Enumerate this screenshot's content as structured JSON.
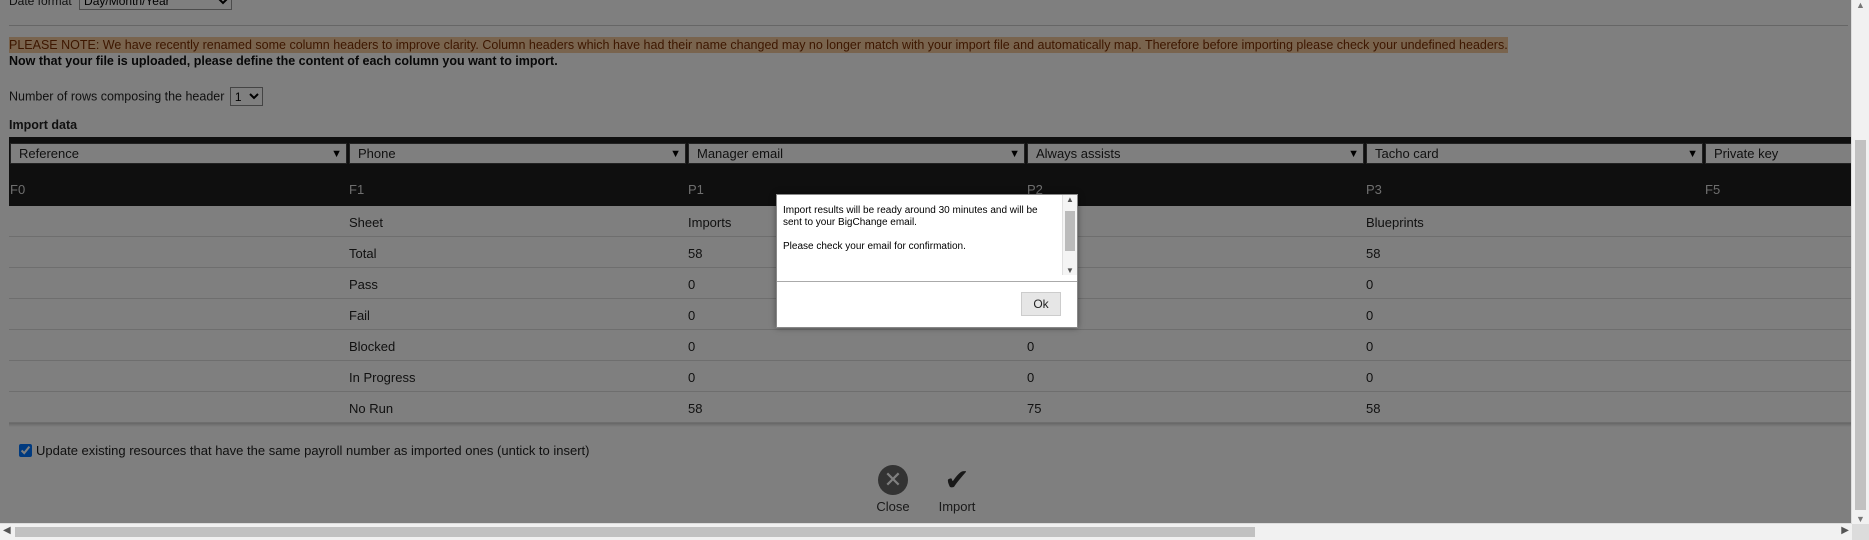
{
  "date_format": {
    "label": "Date format",
    "value": "Day/Month/Year"
  },
  "notice": {
    "warning": "PLEASE NOTE: We have recently renamed some column headers to improve clarity. Column headers which have had their name changed may no longer match with your import file and automatically map. Therefore before importing please check your undefined headers.",
    "instruction": "Now that your file is uploaded, please define the content of each column you want to import."
  },
  "header_rows": {
    "label": "Number of rows composing the header",
    "value": "1"
  },
  "import_title": "Import data",
  "columns": [
    {
      "select": "Reference",
      "code": "F0"
    },
    {
      "select": "Phone",
      "code": "F1"
    },
    {
      "select": "Manager email",
      "code": "P1"
    },
    {
      "select": "Always assists",
      "code": "P2"
    },
    {
      "select": "Tacho card",
      "code": "P3"
    },
    {
      "select": "Private key",
      "code": "F5"
    }
  ],
  "rows": [
    [
      "",
      "Sheet",
      "Imports",
      "",
      "Blueprints",
      ""
    ],
    [
      "",
      "Total",
      "58",
      "",
      "58",
      ""
    ],
    [
      "",
      "Pass",
      "0",
      "",
      "0",
      ""
    ],
    [
      "",
      "Fail",
      "0",
      "",
      "0",
      ""
    ],
    [
      "",
      "Blocked",
      "0",
      "0",
      "0",
      ""
    ],
    [
      "",
      "In Progress",
      "0",
      "0",
      "0",
      ""
    ],
    [
      "",
      "No Run",
      "58",
      "75",
      "58",
      ""
    ]
  ],
  "update_option": {
    "label": "Update existing resources that have the same payroll number as imported ones (untick to insert)",
    "checked": true
  },
  "buttons": {
    "close": "Close",
    "import": "Import"
  },
  "dialog": {
    "message1": "Import results will be ready around 30 minutes and will be sent to your BigChange email.",
    "message2": "Please check your email for confirmation.",
    "ok": "Ok"
  }
}
